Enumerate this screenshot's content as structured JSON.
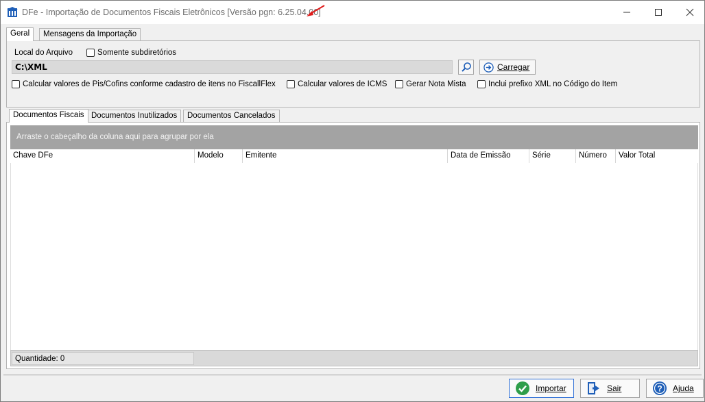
{
  "window": {
    "title": "DFe - Importação de Documentos Fiscais Eletrônicos [Versão pgn: 6.25.04.00]",
    "controls": {
      "minimize": "—",
      "maximize": "☐",
      "close": "✕"
    }
  },
  "outer_tabs": [
    {
      "label": "Geral",
      "active": true
    },
    {
      "label": "Mensagens da Importação",
      "active": false
    }
  ],
  "geral": {
    "file_location_label": "Local do Arquivo",
    "only_subdirs_label": "Somente subdiretórios",
    "path_value": "C:\\XML",
    "load_button_label": "Carregar",
    "options": [
      {
        "label": "Calcular valores de Pis/Cofins conforme cadastro de itens  no FiscallFlex",
        "checked": false
      },
      {
        "label": "Calcular valores de ICMS",
        "checked": false
      },
      {
        "label": "Gerar Nota Mista",
        "checked": false
      },
      {
        "label": "Inclui prefixo XML no Código do Item",
        "checked": false
      }
    ]
  },
  "inner_tabs": [
    {
      "label": "Documentos Fiscais",
      "active": true
    },
    {
      "label": "Documentos Inutilizados",
      "active": false
    },
    {
      "label": "Documentos Cancelados",
      "active": false
    }
  ],
  "grid": {
    "group_hint": "Arraste o cabeçalho da coluna aqui para agrupar por ela",
    "columns": [
      "Chave DFe",
      "Modelo",
      "Emitente",
      "Data de Emissão",
      "Série",
      "Número",
      "Valor Total"
    ],
    "rows": [],
    "quantity_label": "Quantidade: 0"
  },
  "buttons": {
    "import": "Importar",
    "exit": "Sair",
    "help": "Ajuda"
  },
  "colors": {
    "accent_blue": "#2f6fd6",
    "import_green": "#2e9e4a",
    "help_blue": "#1f5fb8",
    "annotation_red": "#e01b1b"
  }
}
